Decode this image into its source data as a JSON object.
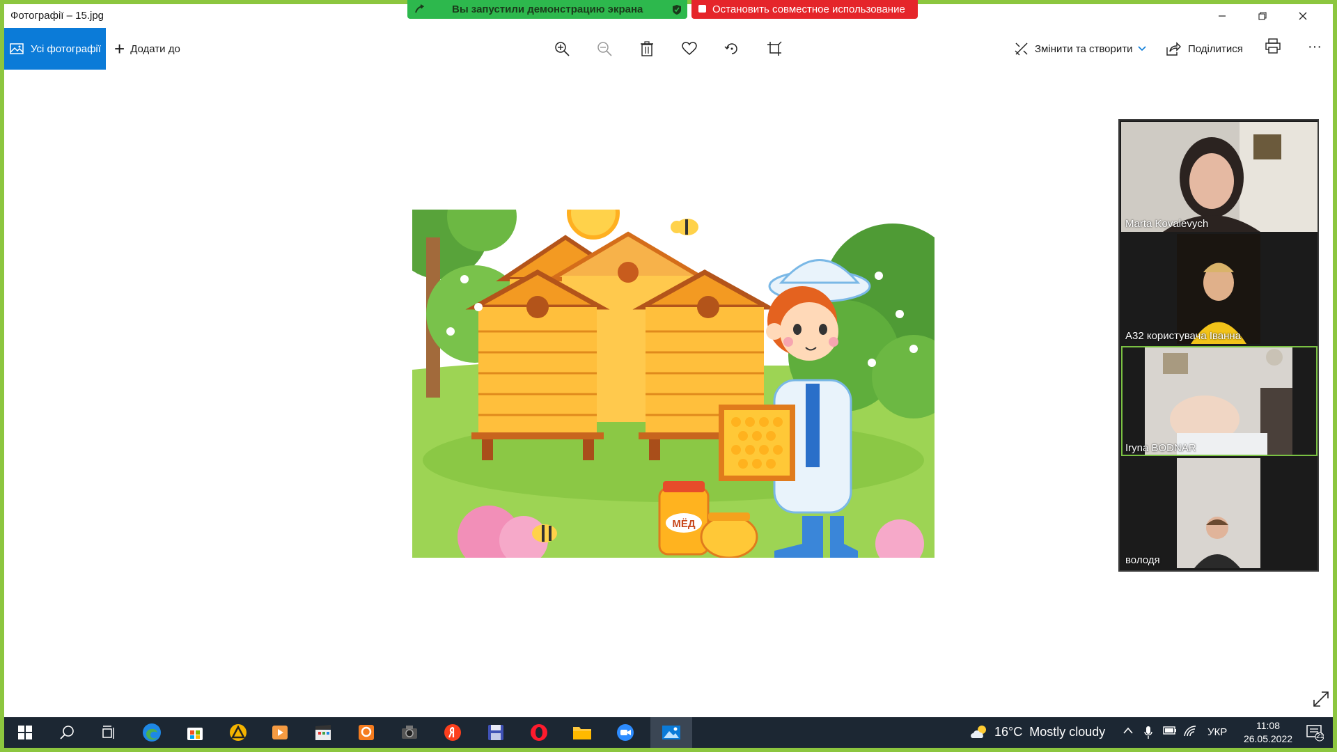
{
  "window": {
    "title": "Фотографії – 15.jpg",
    "controls": [
      "minimize",
      "restore",
      "close"
    ]
  },
  "share_banner": {
    "status_text": "Вы запустили демонстрацию экрана",
    "stop_text": "Остановить совместное использование"
  },
  "toolbar": {
    "all_photos": "Усі фотографії",
    "add_to": "Додати до",
    "edit_create": "Змінити та створити",
    "share": "Поділитися",
    "tools": [
      "zoom-in-icon",
      "zoom-out-icon",
      "delete-icon",
      "favorite-icon",
      "rotate-icon",
      "crop-icon"
    ],
    "more": "···"
  },
  "photo": {
    "jar_label": "МЁД"
  },
  "participants": [
    {
      "name": "Marta Kovalevych",
      "active": false
    },
    {
      "name": "A32 користувача Іванна",
      "active": false
    },
    {
      "name": "Iryna BODNAR",
      "active": true
    },
    {
      "name": "володя",
      "active": false
    }
  ],
  "taskbar": {
    "weather": {
      "temp": "16°C",
      "condition": "Mostly cloudy"
    },
    "language": "УКР",
    "time": "11:08",
    "date": "26.05.2022",
    "notifications": "21"
  },
  "colors": {
    "accent": "#0b7bd8",
    "share_green": "#2db84d",
    "share_red": "#e5252a",
    "taskbar": "#1c2733",
    "frame": "#8cc63f"
  }
}
